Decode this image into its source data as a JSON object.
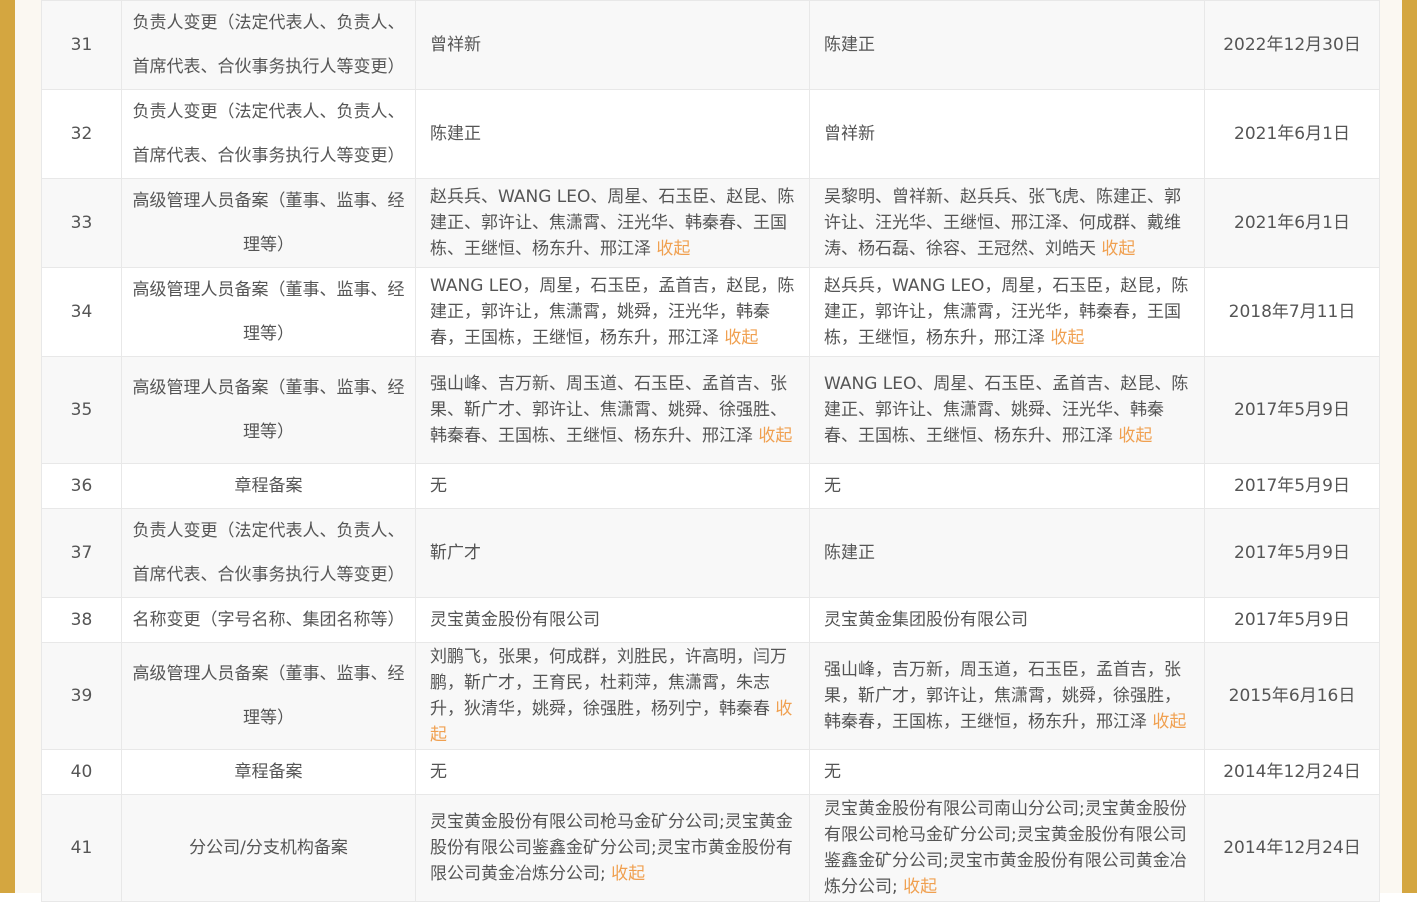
{
  "collapse_label": "收起",
  "rows": [
    {
      "no": "31",
      "item": "负责人变更（法定代表人、负责人、首席代表、合伙事务执行人等变更）",
      "before": "曾祥新",
      "after": "陈建正",
      "date": "2022年12月30日"
    },
    {
      "no": "32",
      "item": "负责人变更（法定代表人、负责人、首席代表、合伙事务执行人等变更）",
      "before": "陈建正",
      "after": "曾祥新",
      "date": "2021年6月1日"
    },
    {
      "no": "33",
      "item": "高级管理人员备案（董事、监事、经理等）",
      "before": "赵兵兵、WANG LEO、周星、石玉臣、赵昆、陈建正、郭许让、焦潇霄、汪光华、韩秦春、王国栋、王继恒、杨东升、邢江泽",
      "after": "吴黎明、曾祥新、赵兵兵、张飞虎、陈建正、郭许让、汪光华、王继恒、邢江泽、何成群、戴维涛、杨石磊、徐容、王冠然、刘皓天",
      "date": "2021年6月1日"
    },
    {
      "no": "34",
      "item": "高级管理人员备案（董事、监事、经理等）",
      "before": "WANG LEO，周星，石玉臣，孟首吉，赵昆，陈建正，郭许让，焦潇霄，姚舜，汪光华，韩秦春，王国栋，王继恒，杨东升，邢江泽",
      "after": "赵兵兵，WANG LEO，周星，石玉臣，赵昆，陈建正，郭许让，焦潇霄，汪光华，韩秦春，王国栋，王继恒，杨东升，邢江泽",
      "date": "2018年7月11日"
    },
    {
      "no": "35",
      "item": "高级管理人员备案（董事、监事、经理等）",
      "before": "强山峰、吉万新、周玉道、石玉臣、孟首吉、张果、靳广才、郭许让、焦潇霄、姚舜、徐强胜、韩秦春、王国栋、王继恒、杨东升、邢江泽",
      "after": "WANG LEO、周星、石玉臣、孟首吉、赵昆、陈建正、郭许让、焦潇霄、姚舜、汪光华、韩秦春、王国栋、王继恒、杨东升、邢江泽",
      "date": "2017年5月9日"
    },
    {
      "no": "36",
      "item": "章程备案",
      "before": "无",
      "after": "无",
      "date": "2017年5月9日"
    },
    {
      "no": "37",
      "item": "负责人变更（法定代表人、负责人、首席代表、合伙事务执行人等变更）",
      "before": "靳广才",
      "after": "陈建正",
      "date": "2017年5月9日"
    },
    {
      "no": "38",
      "item": "名称变更（字号名称、集团名称等）",
      "before": "灵宝黄金股份有限公司",
      "after": "灵宝黄金集团股份有限公司",
      "date": "2017年5月9日"
    },
    {
      "no": "39",
      "item": "高级管理人员备案（董事、监事、经理等）",
      "before": "刘鹏飞，张果，何成群，刘胜民，许高明，闫万鹏，靳广才，王育民，杜莉萍，焦潇霄，朱志升，狄清华，姚舜，徐强胜，杨列宁，韩秦春",
      "after": "强山峰，吉万新，周玉道，石玉臣，孟首吉，张果，靳广才，郭许让，焦潇霄，姚舜，徐强胜，韩秦春，王国栋，王继恒，杨东升，邢江泽",
      "date": "2015年6月16日"
    },
    {
      "no": "40",
      "item": "章程备案",
      "before": "无",
      "after": "无",
      "date": "2014年12月24日"
    },
    {
      "no": "41",
      "item": "分公司/分支机构备案",
      "before": "灵宝黄金股份有限公司枪马金矿分公司;灵宝黄金股份有限公司鉴鑫金矿分公司;灵宝市黄金股份有限公司黄金冶炼分公司;",
      "after": "灵宝黄金股份有限公司南山分公司;灵宝黄金股份有限公司枪马金矿分公司;灵宝黄金股份有限公司鉴鑫金矿分公司;灵宝市黄金股份有限公司黄金冶炼分公司;",
      "date": "2014年12月24日"
    }
  ]
}
